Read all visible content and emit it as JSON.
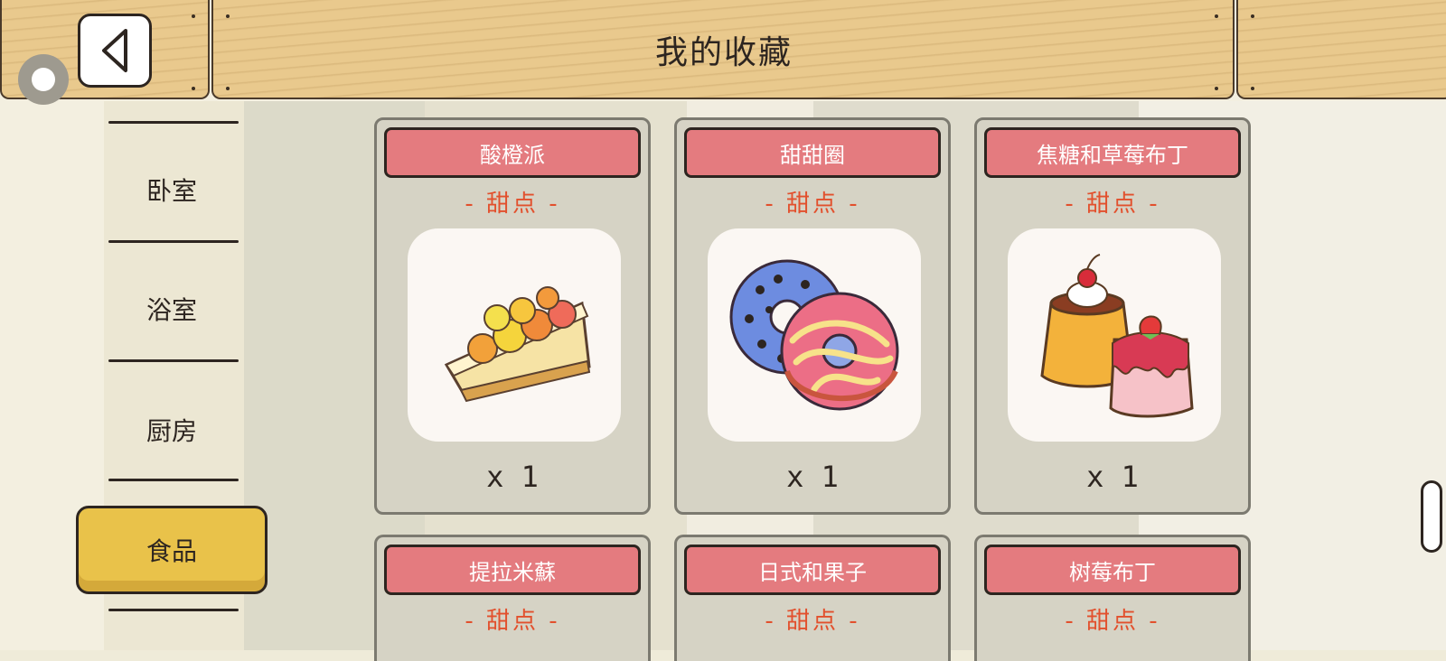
{
  "header": {
    "title": "我的收藏"
  },
  "sidebar": {
    "items": [
      {
        "label": "卧室"
      },
      {
        "label": "浴室"
      },
      {
        "label": "厨房"
      },
      {
        "label": "食品"
      }
    ]
  },
  "cards": [
    {
      "name": "酸橙派",
      "category": "- 甜点 -",
      "count": "x 1"
    },
    {
      "name": "甜甜圈",
      "category": "- 甜点 -",
      "count": "x 1"
    },
    {
      "name": "焦糖和草莓布丁",
      "category": "- 甜点 -",
      "count": "x 1"
    },
    {
      "name": "提拉米蘇",
      "category": "- 甜点 -"
    },
    {
      "name": "日式和果子",
      "category": "- 甜点 -"
    },
    {
      "name": "树莓布丁",
      "category": "- 甜点 -"
    }
  ],
  "colors": {
    "accent_yellow": "#e9c24a",
    "card_title_pink": "#e47b7f",
    "category_orange": "#e2502d",
    "wood": "#e9c98d"
  }
}
